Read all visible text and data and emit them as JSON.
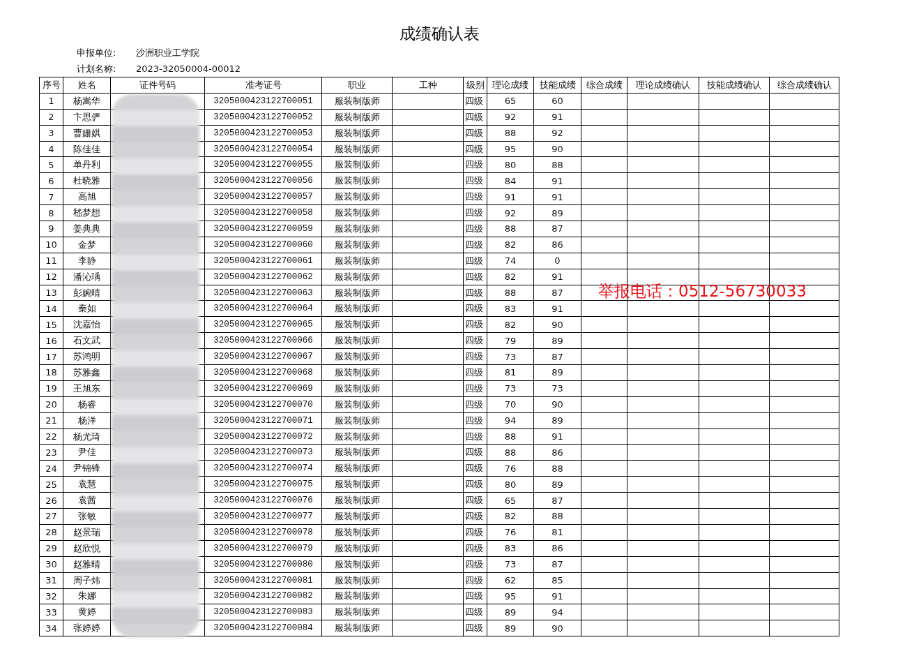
{
  "title": "成绩确认表",
  "info": [
    {
      "label": "申报单位:",
      "value": "沙洲职业工学院"
    },
    {
      "label": "计划名称:",
      "value": "2023-32050004-00012"
    }
  ],
  "table": {
    "columns": [
      "序号",
      "姓名",
      "证件号码",
      "准考证号",
      "职业",
      "工种",
      "级别",
      "理论成绩",
      "技能成绩",
      "综合成绩",
      "理论成绩确认",
      "技能成绩确认",
      "综合成绩确认"
    ],
    "rows": [
      {
        "no": "1",
        "name": "杨嵩华",
        "exam_no": "3205000423122700051",
        "occupation": "服装制版师",
        "level": "四级",
        "theory": "65",
        "skill": "60"
      },
      {
        "no": "2",
        "name": "卞思俨",
        "exam_no": "3205000423122700052",
        "occupation": "服装制版师",
        "level": "四级",
        "theory": "92",
        "skill": "91"
      },
      {
        "no": "3",
        "name": "曹姗娸",
        "exam_no": "3205000423122700053",
        "occupation": "服装制版师",
        "level": "四级",
        "theory": "88",
        "skill": "92"
      },
      {
        "no": "4",
        "name": "陈佳佳",
        "exam_no": "3205000423122700054",
        "occupation": "服装制版师",
        "level": "四级",
        "theory": "95",
        "skill": "90"
      },
      {
        "no": "5",
        "name": "单丹利",
        "exam_no": "3205000423122700055",
        "occupation": "服装制版师",
        "level": "四级",
        "theory": "80",
        "skill": "88"
      },
      {
        "no": "6",
        "name": "杜晓雅",
        "exam_no": "3205000423122700056",
        "occupation": "服装制版师",
        "level": "四级",
        "theory": "84",
        "skill": "91"
      },
      {
        "no": "7",
        "name": "高旭",
        "exam_no": "3205000423122700057",
        "occupation": "服装制版师",
        "level": "四级",
        "theory": "91",
        "skill": "91"
      },
      {
        "no": "8",
        "name": "嵇梦想",
        "exam_no": "3205000423122700058",
        "occupation": "服装制版师",
        "level": "四级",
        "theory": "92",
        "skill": "89"
      },
      {
        "no": "9",
        "name": "姜典典",
        "exam_no": "3205000423122700059",
        "occupation": "服装制版师",
        "level": "四级",
        "theory": "88",
        "skill": "87"
      },
      {
        "no": "10",
        "name": "金梦",
        "exam_no": "3205000423122700060",
        "occupation": "服装制版师",
        "level": "四级",
        "theory": "82",
        "skill": "86"
      },
      {
        "no": "11",
        "name": "李静",
        "exam_no": "3205000423122700061",
        "occupation": "服装制版师",
        "level": "四级",
        "theory": "74",
        "skill": "0"
      },
      {
        "no": "12",
        "name": "潘沁瑀",
        "exam_no": "3205000423122700062",
        "occupation": "服装制版师",
        "level": "四级",
        "theory": "82",
        "skill": "91"
      },
      {
        "no": "13",
        "name": "彭婉晴",
        "exam_no": "3205000423122700063",
        "occupation": "服装制版师",
        "level": "四级",
        "theory": "88",
        "skill": "87"
      },
      {
        "no": "14",
        "name": "秦如",
        "exam_no": "3205000423122700064",
        "occupation": "服装制版师",
        "level": "四级",
        "theory": "83",
        "skill": "91"
      },
      {
        "no": "15",
        "name": "沈嘉怡",
        "exam_no": "3205000423122700065",
        "occupation": "服装制版师",
        "level": "四级",
        "theory": "82",
        "skill": "90"
      },
      {
        "no": "16",
        "name": "石文武",
        "exam_no": "3205000423122700066",
        "occupation": "服装制版师",
        "level": "四级",
        "theory": "79",
        "skill": "89"
      },
      {
        "no": "17",
        "name": "苏鸿明",
        "exam_no": "3205000423122700067",
        "occupation": "服装制版师",
        "level": "四级",
        "theory": "73",
        "skill": "87"
      },
      {
        "no": "18",
        "name": "苏雅鑫",
        "exam_no": "3205000423122700068",
        "occupation": "服装制版师",
        "level": "四级",
        "theory": "81",
        "skill": "89"
      },
      {
        "no": "19",
        "name": "王旭东",
        "exam_no": "3205000423122700069",
        "occupation": "服装制版师",
        "level": "四级",
        "theory": "73",
        "skill": "73"
      },
      {
        "no": "20",
        "name": "杨睿",
        "exam_no": "3205000423122700070",
        "occupation": "服装制版师",
        "level": "四级",
        "theory": "70",
        "skill": "90"
      },
      {
        "no": "21",
        "name": "杨洋",
        "exam_no": "3205000423122700071",
        "occupation": "服装制版师",
        "level": "四级",
        "theory": "94",
        "skill": "89"
      },
      {
        "no": "22",
        "name": "杨尤琦",
        "exam_no": "3205000423122700072",
        "occupation": "服装制版师",
        "level": "四级",
        "theory": "88",
        "skill": "91"
      },
      {
        "no": "23",
        "name": "尹佳",
        "exam_no": "3205000423122700073",
        "occupation": "服装制版师",
        "level": "四级",
        "theory": "88",
        "skill": "86"
      },
      {
        "no": "24",
        "name": "尹锦锋",
        "exam_no": "3205000423122700074",
        "occupation": "服装制版师",
        "level": "四级",
        "theory": "76",
        "skill": "88"
      },
      {
        "no": "25",
        "name": "袁慧",
        "exam_no": "3205000423122700075",
        "occupation": "服装制版师",
        "level": "四级",
        "theory": "80",
        "skill": "89"
      },
      {
        "no": "26",
        "name": "袁茜",
        "exam_no": "3205000423122700076",
        "occupation": "服装制版师",
        "level": "四级",
        "theory": "65",
        "skill": "87"
      },
      {
        "no": "27",
        "name": "张敏",
        "exam_no": "3205000423122700077",
        "occupation": "服装制版师",
        "level": "四级",
        "theory": "82",
        "skill": "88"
      },
      {
        "no": "28",
        "name": "赵景瑞",
        "exam_no": "3205000423122700078",
        "occupation": "服装制版师",
        "level": "四级",
        "theory": "76",
        "skill": "81"
      },
      {
        "no": "29",
        "name": "赵欣悦",
        "exam_no": "3205000423122700079",
        "occupation": "服装制版师",
        "level": "四级",
        "theory": "83",
        "skill": "86"
      },
      {
        "no": "30",
        "name": "赵雅晴",
        "exam_no": "3205000423122700080",
        "occupation": "服装制版师",
        "level": "四级",
        "theory": "73",
        "skill": "87"
      },
      {
        "no": "31",
        "name": "周子炜",
        "exam_no": "3205000423122700081",
        "occupation": "服装制版师",
        "level": "四级",
        "theory": "62",
        "skill": "85"
      },
      {
        "no": "32",
        "name": "朱娜",
        "exam_no": "3205000423122700082",
        "occupation": "服装制版师",
        "level": "四级",
        "theory": "95",
        "skill": "91"
      },
      {
        "no": "33",
        "name": "黄婷",
        "exam_no": "3205000423122700083",
        "occupation": "服装制版师",
        "level": "四级",
        "theory": "89",
        "skill": "94"
      },
      {
        "no": "34",
        "name": "张婷婷",
        "exam_no": "3205000423122700084",
        "occupation": "服装制版师",
        "level": "四级",
        "theory": "89",
        "skill": "90"
      }
    ]
  },
  "hotline": "举报电话：0512-56730033"
}
